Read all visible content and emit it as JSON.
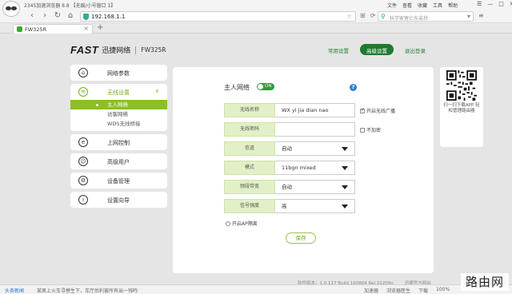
{
  "browser": {
    "window_title": "2345加速浏览器 8.8 【无痕/小号窗口 1】",
    "menu": [
      "文件",
      "查看",
      "收藏",
      "工具",
      "帮助"
    ],
    "window_controls": [
      "☰",
      "—",
      "□",
      "✕"
    ],
    "url": "192.168.1.1",
    "search_placeholder": "科学家寄亡东诺世",
    "tab_title": "FW325R",
    "tab_close": "×",
    "new_tab": "+",
    "icons": {
      "back": "‹",
      "forward": "›",
      "reload": "↻",
      "home": "⌂",
      "star": "☆",
      "grid": "⊞",
      "refresh": "⟳",
      "search": "⚲",
      "go": "▾",
      "menu_right": "≡"
    }
  },
  "brand": {
    "logo": "FAST",
    "name_cn": "迅捷网络",
    "model": "FW325R"
  },
  "top_tabs": [
    {
      "label": "常用设置",
      "active": false
    },
    {
      "label": "高级设置",
      "active": true
    },
    {
      "label": "退出登录",
      "active": false
    }
  ],
  "sidebar": {
    "items_top": [
      {
        "label": "网络参数",
        "icon": "⌂"
      }
    ],
    "wireless": {
      "label": "无线设置",
      "icon": "≋",
      "chevron": "∨",
      "sub": [
        {
          "label": "主人网络",
          "active": true
        },
        {
          "label": "访客网络",
          "active": false
        },
        {
          "label": "WDS无线桥接",
          "active": false
        }
      ]
    },
    "items_bottom": [
      {
        "label": "上网控制",
        "icon": "e"
      },
      {
        "label": "高级用户",
        "icon": "☺"
      },
      {
        "label": "设备管理",
        "icon": "⚙"
      },
      {
        "label": "设置向导",
        "icon": "i"
      }
    ]
  },
  "main": {
    "title": "主人网络",
    "toggle_label": "ON",
    "help": "?",
    "fields": [
      {
        "label": "无线名称",
        "value": "WX yi jia dian nao",
        "dropdown": false,
        "extra": {
          "label": "开启无线广播",
          "checked": true
        }
      },
      {
        "label": "无线密码",
        "value": "",
        "dropdown": false,
        "extra": {
          "label": "不加密",
          "checked": false
        }
      },
      {
        "label": "信道",
        "value": "自动",
        "dropdown": true
      },
      {
        "label": "模式",
        "value": "11bgn mixed",
        "dropdown": true
      },
      {
        "label": "频段带宽",
        "value": "自动",
        "dropdown": true
      },
      {
        "label": "信号强度",
        "value": "高",
        "dropdown": true
      }
    ],
    "ap_isolation": "开启AP隔离",
    "save": "保存"
  },
  "qr": {
    "caption": "扫一扫下载APP 轻松管理路由器"
  },
  "footer": {
    "version": "软件版本：1.0.117 Build 160804 Rel.31209n",
    "official": "迅捷官方网站"
  },
  "statusbar": {
    "news": "头条新闻",
    "ticker": "某男上火车寻替生下，车厅后利害所有出一钱鸣",
    "right": [
      "加速器",
      "浏览器医生",
      "下载",
      "100%"
    ]
  },
  "watermark": "路由网"
}
